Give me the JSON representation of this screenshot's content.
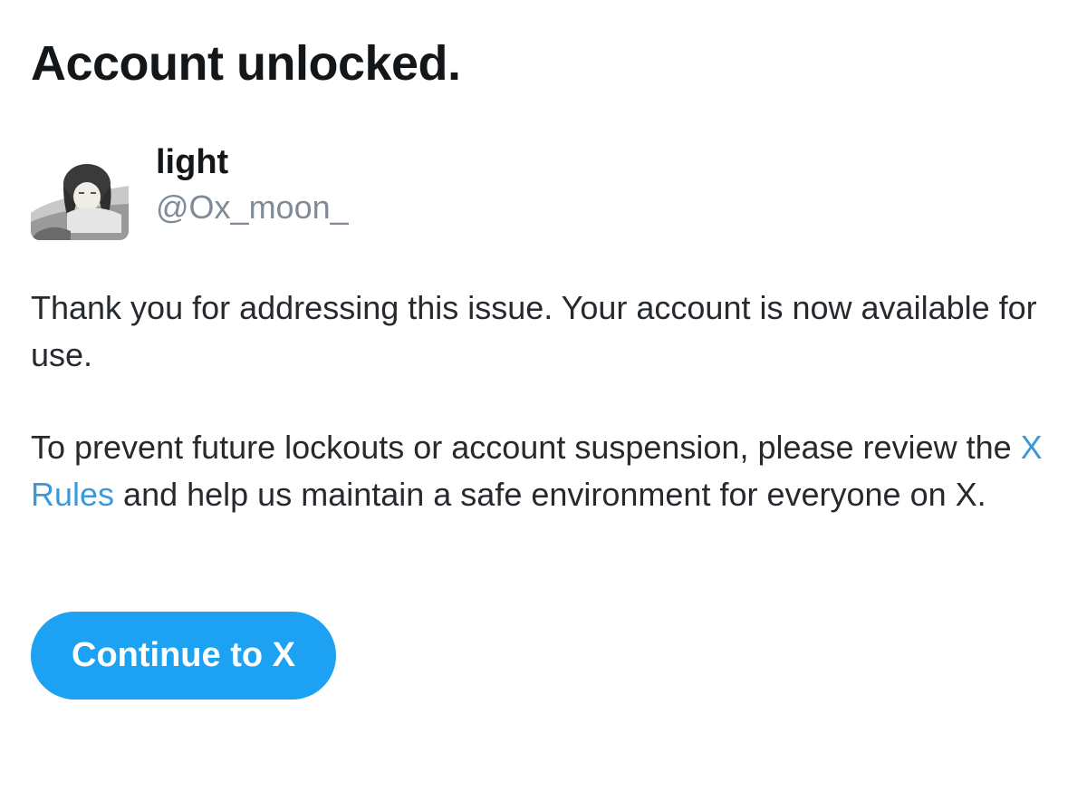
{
  "header": {
    "title": "Account unlocked."
  },
  "user": {
    "name": "light",
    "handle": "@Ox_moon_",
    "avatar_icon": "profile-picture"
  },
  "message": {
    "paragraph1": "Thank you for addressing this issue. Your account is now available for use.",
    "paragraph2_before": "To prevent future lockouts or account suspension, please review the ",
    "paragraph2_link": "X Rules",
    "paragraph2_after": " and help us maintain a safe environment for everyone on X."
  },
  "actions": {
    "continue_label": "Continue to X"
  },
  "colors": {
    "accent": "#1da1f2",
    "link": "#3a9ad9",
    "text": "#14171a",
    "muted": "#7f8c97"
  }
}
